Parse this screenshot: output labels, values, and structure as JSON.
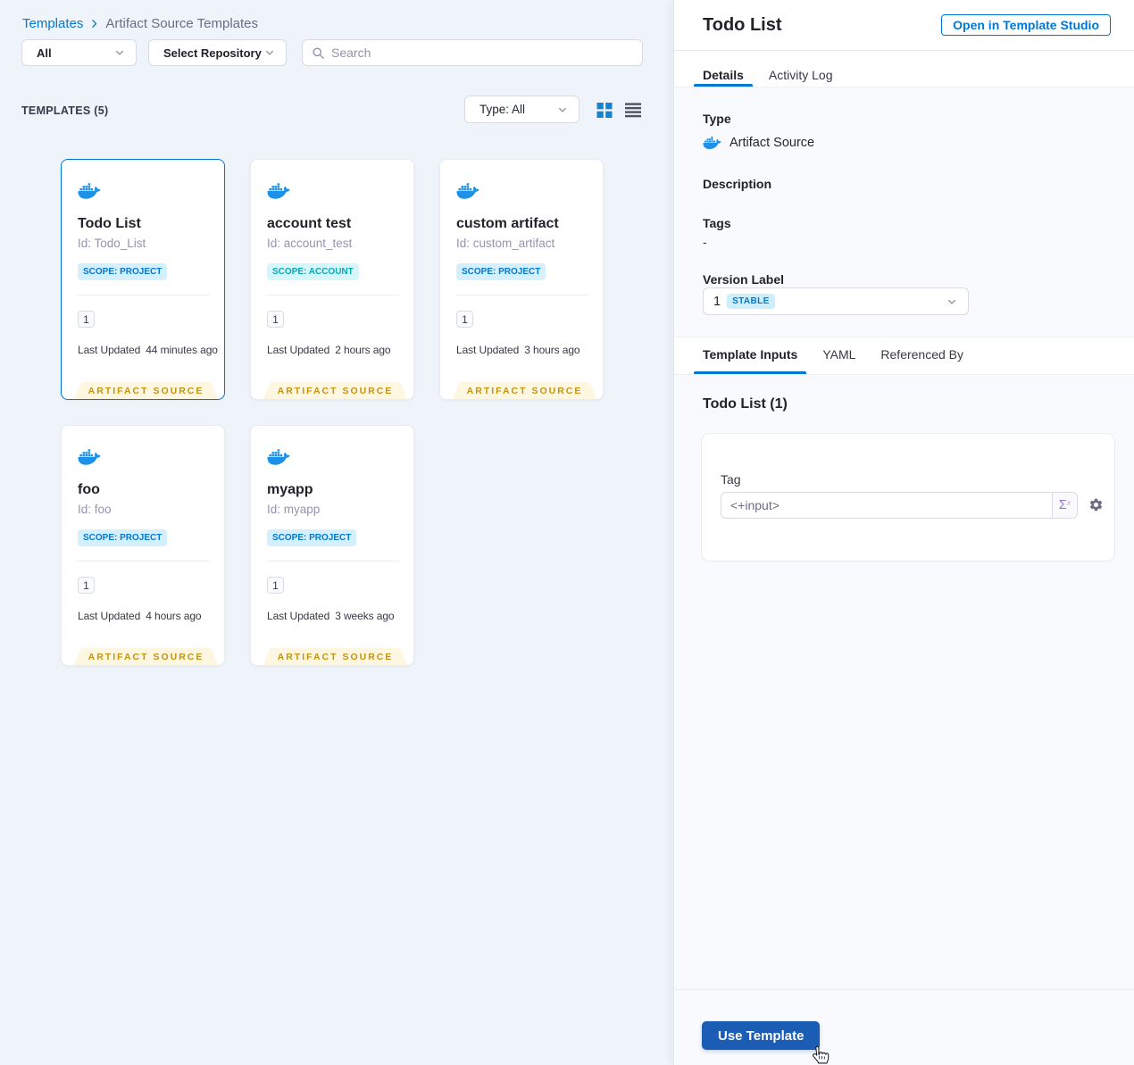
{
  "breadcrumb": {
    "root": "Templates",
    "current": "Artifact Source Templates"
  },
  "filters": {
    "scope_select": "All",
    "repository_select": "Select Repository",
    "search_placeholder": "Search"
  },
  "list_header": {
    "count_label": "TEMPLATES (5)",
    "type_select": "Type: All"
  },
  "cards": [
    {
      "title": "Todo List",
      "id": "Id: Todo_List",
      "scope": "SCOPE: PROJECT",
      "version": "1",
      "updated_label": "Last Updated",
      "updated": "44 minutes ago",
      "footer": "ARTIFACT SOURCE"
    },
    {
      "title": "account test",
      "id": "Id: account_test",
      "scope": "SCOPE: ACCOUNT",
      "version": "1",
      "updated_label": "Last Updated",
      "updated": "2 hours ago",
      "footer": "ARTIFACT SOURCE"
    },
    {
      "title": "custom artifact",
      "id": "Id: custom_artifact",
      "scope": "SCOPE: PROJECT",
      "version": "1",
      "updated_label": "Last Updated",
      "updated": "3 hours ago",
      "footer": "ARTIFACT SOURCE"
    },
    {
      "title": "foo",
      "id": "Id: foo",
      "scope": "SCOPE: PROJECT",
      "version": "1",
      "updated_label": "Last Updated",
      "updated": "4 hours ago",
      "footer": "ARTIFACT SOURCE"
    },
    {
      "title": "myapp",
      "id": "Id: myapp",
      "scope": "SCOPE: PROJECT",
      "version": "1",
      "updated_label": "Last Updated",
      "updated": "3 weeks ago",
      "footer": "ARTIFACT SOURCE"
    }
  ],
  "details_panel": {
    "title": "Todo List",
    "open_button": "Open in Template Studio",
    "tab_details": "Details",
    "tab_activity": "Activity Log",
    "type_label": "Type",
    "type_value": "Artifact Source",
    "description_label": "Description",
    "tags_label": "Tags",
    "tags_value": "-",
    "version_label": "Version Label",
    "version_value": "1",
    "version_badge": "STABLE",
    "tab_inputs": "Template Inputs",
    "tab_yaml": "YAML",
    "tab_referenced": "Referenced By",
    "inputs_heading": "Todo List (1)",
    "tag_label": "Tag",
    "tag_placeholder": "<+input>",
    "expression_symbol": "Σ",
    "expression_sup": "x",
    "use_template": "Use Template"
  },
  "colors": {
    "primary": "#0278d5",
    "docker_blue": "#1d90e8",
    "ribbon_bg": "#fdf6e0",
    "ribbon_text": "#c8930c",
    "use_template_bg": "#1b5cb4",
    "left_bg": "#eef4f9",
    "right_bg": "#f8fafd"
  }
}
